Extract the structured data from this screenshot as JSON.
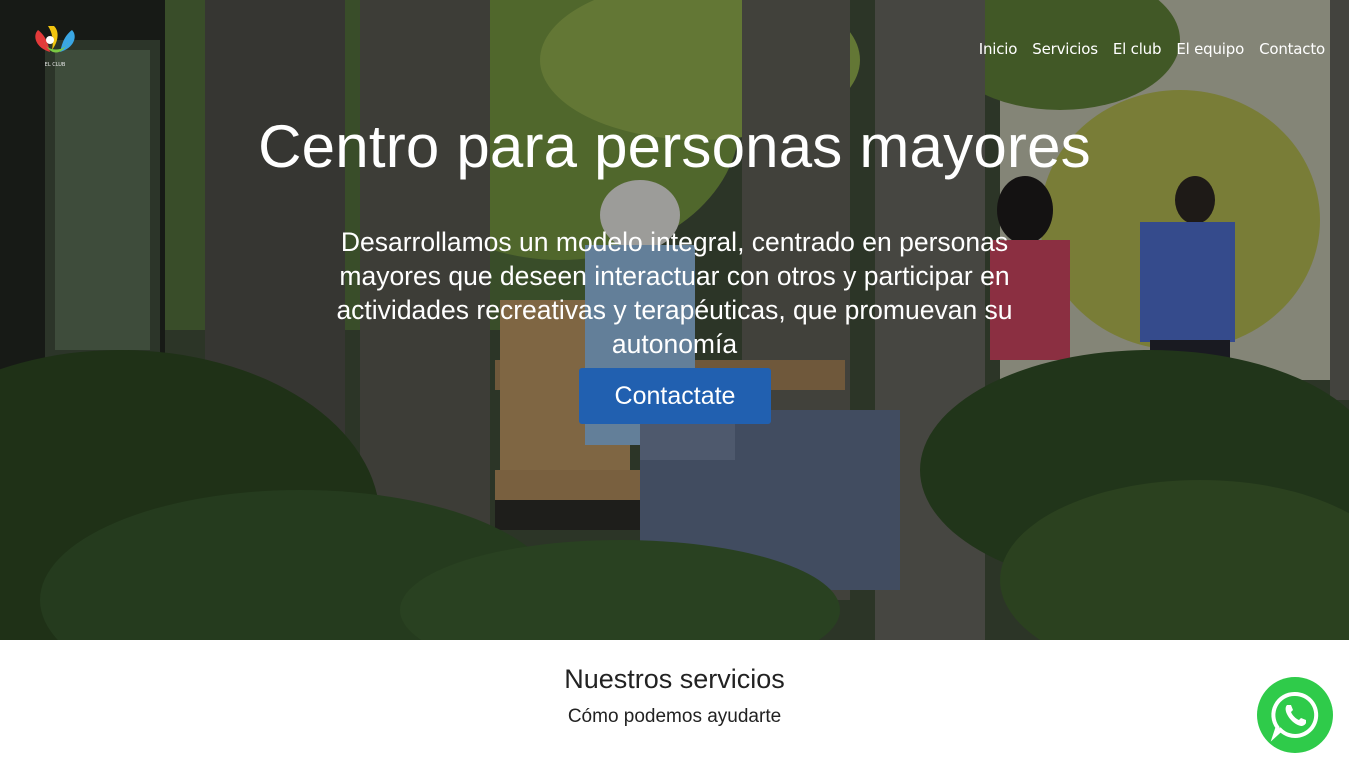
{
  "header": {
    "logo_text": "EL CLUB",
    "nav": [
      {
        "label": "Inicio"
      },
      {
        "label": "Servicios"
      },
      {
        "label": "El club"
      },
      {
        "label": "El equipo"
      },
      {
        "label": "Contacto"
      }
    ]
  },
  "hero": {
    "title": "Centro para personas mayores",
    "subtitle": "Desarrollamos un modelo integral, centrado en personas mayores que deseen interactuar con otros y participar en actividades recreativas y terapéuticas, que promuevan su autonomía",
    "cta_label": "Contactate"
  },
  "services": {
    "title": "Nuestros servicios",
    "subtitle": "Cómo podemos ayudarte"
  },
  "colors": {
    "cta": "#2160b0",
    "whatsapp": "#2fcb4a"
  },
  "icons": {
    "whatsapp": "whatsapp-icon",
    "logo": "club-logo"
  }
}
